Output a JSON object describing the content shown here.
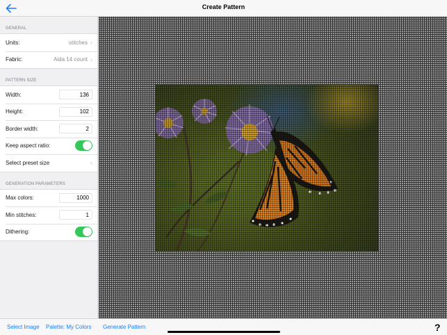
{
  "header": {
    "title": "Create Pattern",
    "back_icon": "back-arrow-icon"
  },
  "sidebar": {
    "general": {
      "header": "GENERAL",
      "units": {
        "label": "Units:",
        "value": "stitches"
      },
      "fabric": {
        "label": "Fabric:",
        "value": "Aida 14 count"
      }
    },
    "pattern_size": {
      "header": "PATTERN SIZE",
      "width": {
        "label": "Width:",
        "value": "136"
      },
      "height": {
        "label": "Height:",
        "value": "102"
      },
      "border_width": {
        "label": "Border width:",
        "value": "2"
      },
      "keep_aspect": {
        "label": "Keep aspect ratio:",
        "on": true
      },
      "preset": {
        "label": "Select preset size"
      }
    },
    "generation": {
      "header": "GENERATION PARAMETERS",
      "max_colors": {
        "label": "Max colors:",
        "value": "1000"
      },
      "min_stitches": {
        "label": "Min stitches:",
        "value": "1"
      },
      "dithering": {
        "label": "Dithering:",
        "on": true
      }
    }
  },
  "toolbar": {
    "select_image": "Select Image",
    "palette": "Palette: My Colors",
    "generate": "Generate Pattern",
    "help": "?"
  },
  "colors": {
    "accent": "#1a7cf5",
    "toggle_on": "#34c759"
  }
}
